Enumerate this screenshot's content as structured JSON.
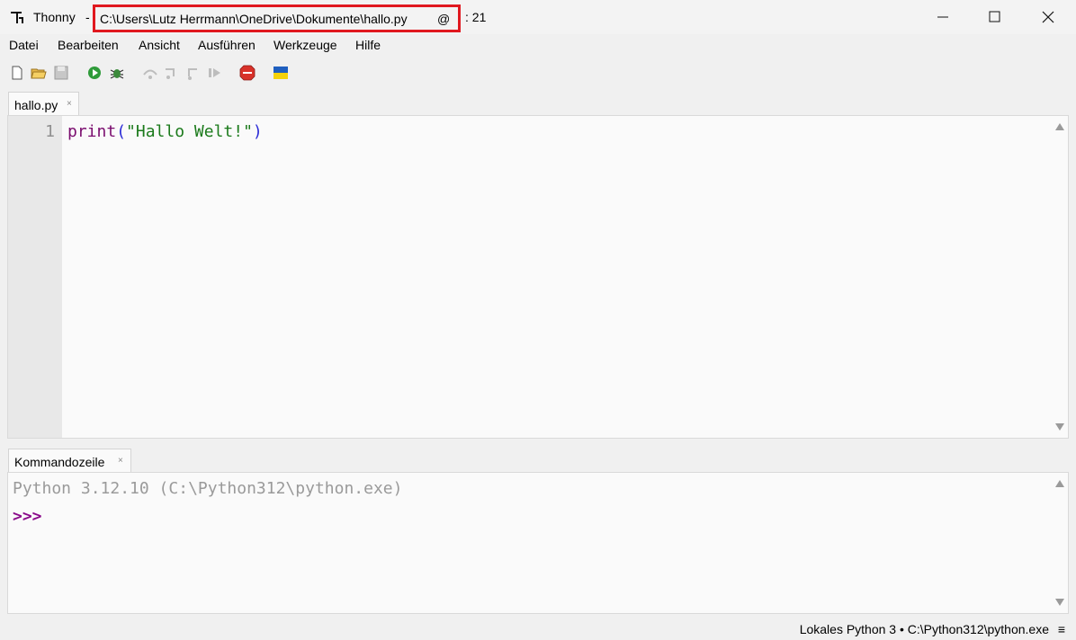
{
  "window": {
    "app_name": "Thonny",
    "separator": "-",
    "file_path": "C:\\Users\\Lutz Herrmann\\OneDrive\\Dokumente\\hallo.py",
    "at_sign": "@",
    "cursor_pos": ": 21"
  },
  "menu": [
    "Datei",
    "Bearbeiten",
    "Ansicht",
    "Ausführen",
    "Werkzeuge",
    "Hilfe"
  ],
  "toolbar": {
    "icons": [
      "new-file-icon",
      "open-folder-icon",
      "save-icon",
      "run-icon",
      "debug-icon",
      "step-over-icon",
      "step-into-icon",
      "step-out-icon",
      "resume-icon",
      "stop-icon",
      "ukraine-flag-icon"
    ]
  },
  "editor": {
    "tab_label": "hallo.py",
    "tab_close": "×",
    "line_number": "1",
    "code": {
      "keyword": "print",
      "open_paren": "(",
      "string": "\"Hallo Welt!\"",
      "close_paren": ")"
    }
  },
  "shell": {
    "tab_label": "Kommandozeile",
    "tab_close": "×",
    "banner": "Python 3.12.10 (C:\\Python312\\python.exe)",
    "prompt": ">>>"
  },
  "status": {
    "interpreter": "Lokales Python 3  •  C:\\Python312\\python.exe",
    "menu_icon": "≡"
  },
  "colors": {
    "highlight_box": "#e0181f",
    "keyword": "#7a0c6e",
    "string": "#1b7a1b",
    "prompt": "#8a0a8a"
  }
}
